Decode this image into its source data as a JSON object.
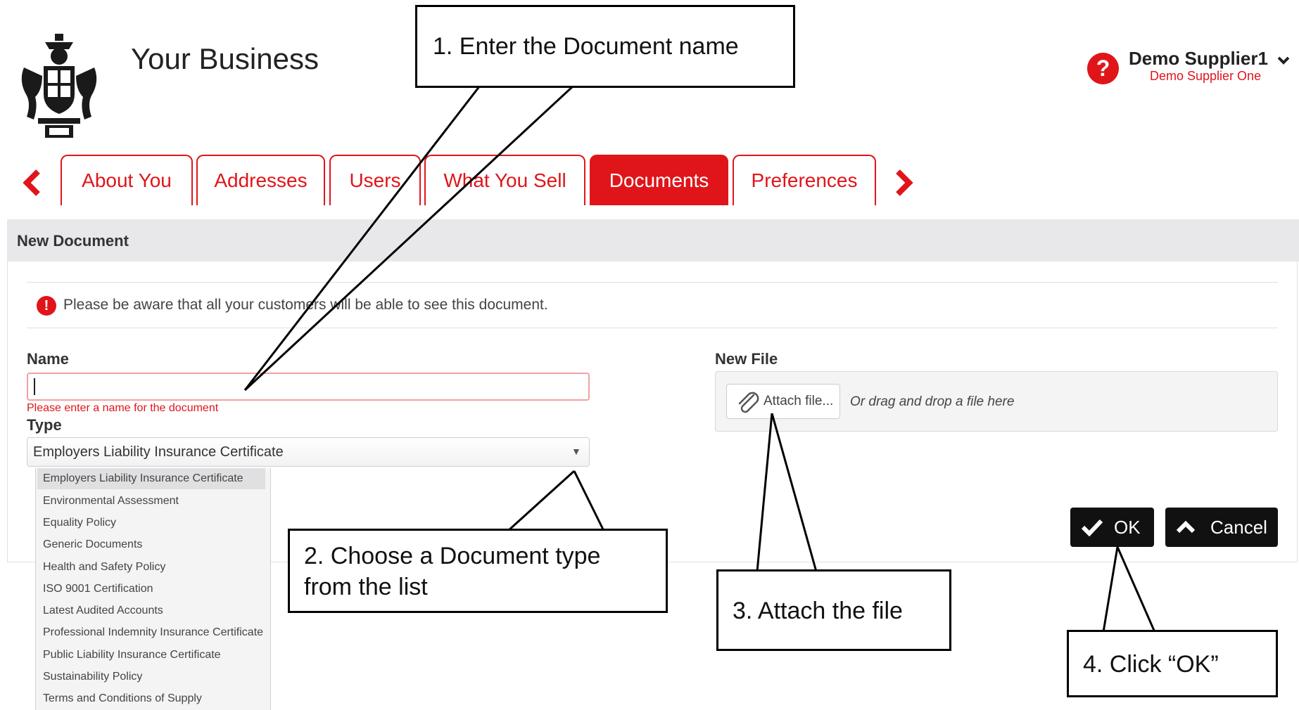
{
  "header": {
    "app_title": "Your Business",
    "logo_icon": "royal-coat-of-arms-logo",
    "help_icon": "question-circle-icon",
    "user_name": "Demo Supplier1",
    "user_company": "Demo Supplier One"
  },
  "tabs": [
    {
      "label": "About You",
      "active": false
    },
    {
      "label": "Addresses",
      "active": false
    },
    {
      "label": "Users",
      "active": false
    },
    {
      "label": "What You Sell",
      "active": false
    },
    {
      "label": "Documents",
      "active": true
    },
    {
      "label": "Preferences",
      "active": false
    }
  ],
  "section": {
    "title": "New Document",
    "warning": "Please be aware that all your customers will be able to see this document."
  },
  "form": {
    "name_label": "Name",
    "name_value": "",
    "name_error": "Please enter a name for the document",
    "type_label": "Type",
    "type_value": "Employers Liability Insurance Certificate",
    "type_options": [
      "Employers Liability Insurance Certificate",
      "Environmental Assessment",
      "Equality Policy",
      "Generic Documents",
      "Health and Safety Policy",
      "ISO 9001 Certification",
      "Latest Audited Accounts",
      "Professional Indemnity Insurance Certificate",
      "Public Liability Insurance Certificate",
      "Sustainability Policy",
      "Terms and Conditions of Supply"
    ],
    "file_label": "New File",
    "attach_label": "Attach file...",
    "drop_hint": "Or drag and drop a file here"
  },
  "actions": {
    "ok_label": "OK",
    "cancel_label": "Cancel"
  },
  "callouts": {
    "step1": "1. Enter the Document name",
    "step2_line1": "2. Choose a Document type",
    "step2_line2": "from the list",
    "step3": "3. Attach the file",
    "step4": "4. Click “OK”"
  },
  "colors": {
    "brand_red": "#e0151a",
    "button_dark": "#111111"
  }
}
